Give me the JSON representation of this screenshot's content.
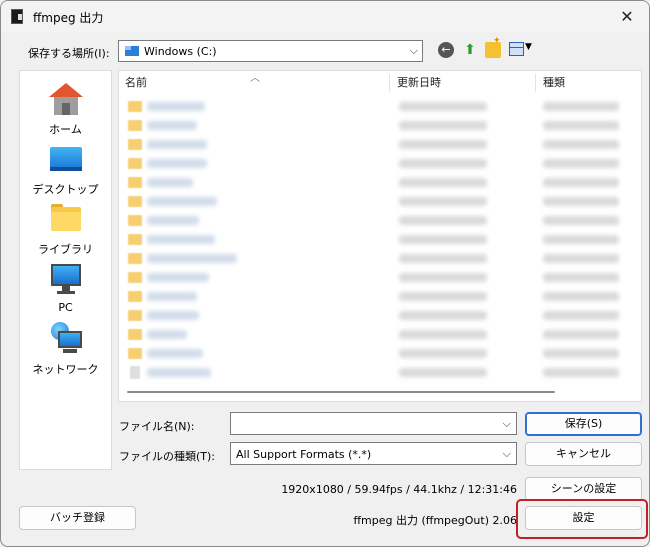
{
  "window": {
    "title": "ffmpeg 出力"
  },
  "location": {
    "label": "保存する場所(I):",
    "value": "Windows (C:)"
  },
  "places": [
    "ホーム",
    "デスクトップ",
    "ライブラリ",
    "PC",
    "ネットワーク"
  ],
  "columns": {
    "name": "名前",
    "modified": "更新日時",
    "type": "種類"
  },
  "file_rows": [
    {
      "kind": "folder"
    },
    {
      "kind": "folder"
    },
    {
      "kind": "folder"
    },
    {
      "kind": "folder"
    },
    {
      "kind": "folder"
    },
    {
      "kind": "folder"
    },
    {
      "kind": "folder"
    },
    {
      "kind": "folder"
    },
    {
      "kind": "folder"
    },
    {
      "kind": "folder"
    },
    {
      "kind": "folder"
    },
    {
      "kind": "folder"
    },
    {
      "kind": "folder"
    },
    {
      "kind": "folder"
    },
    {
      "kind": "file"
    },
    {
      "kind": "file"
    }
  ],
  "form": {
    "filename_label": "ファイル名(N):",
    "filename_value": "",
    "filetype_label": "ファイルの種類(T):",
    "filetype_value": "All Support Formats (*.*)"
  },
  "buttons": {
    "save": "保存(S)",
    "cancel": "キャンセル",
    "scene_settings": "シーンの設定",
    "settings": "設定",
    "batch": "バッチ登録"
  },
  "status": {
    "media_info": "1920x1080 / 59.94fps / 44.1khz / 12:31:46",
    "plugin": "ffmpeg 出力 (ffmpegOut) 2.06"
  },
  "colors": {
    "accent": "#2f6fd1",
    "highlight": "#c0202a"
  }
}
